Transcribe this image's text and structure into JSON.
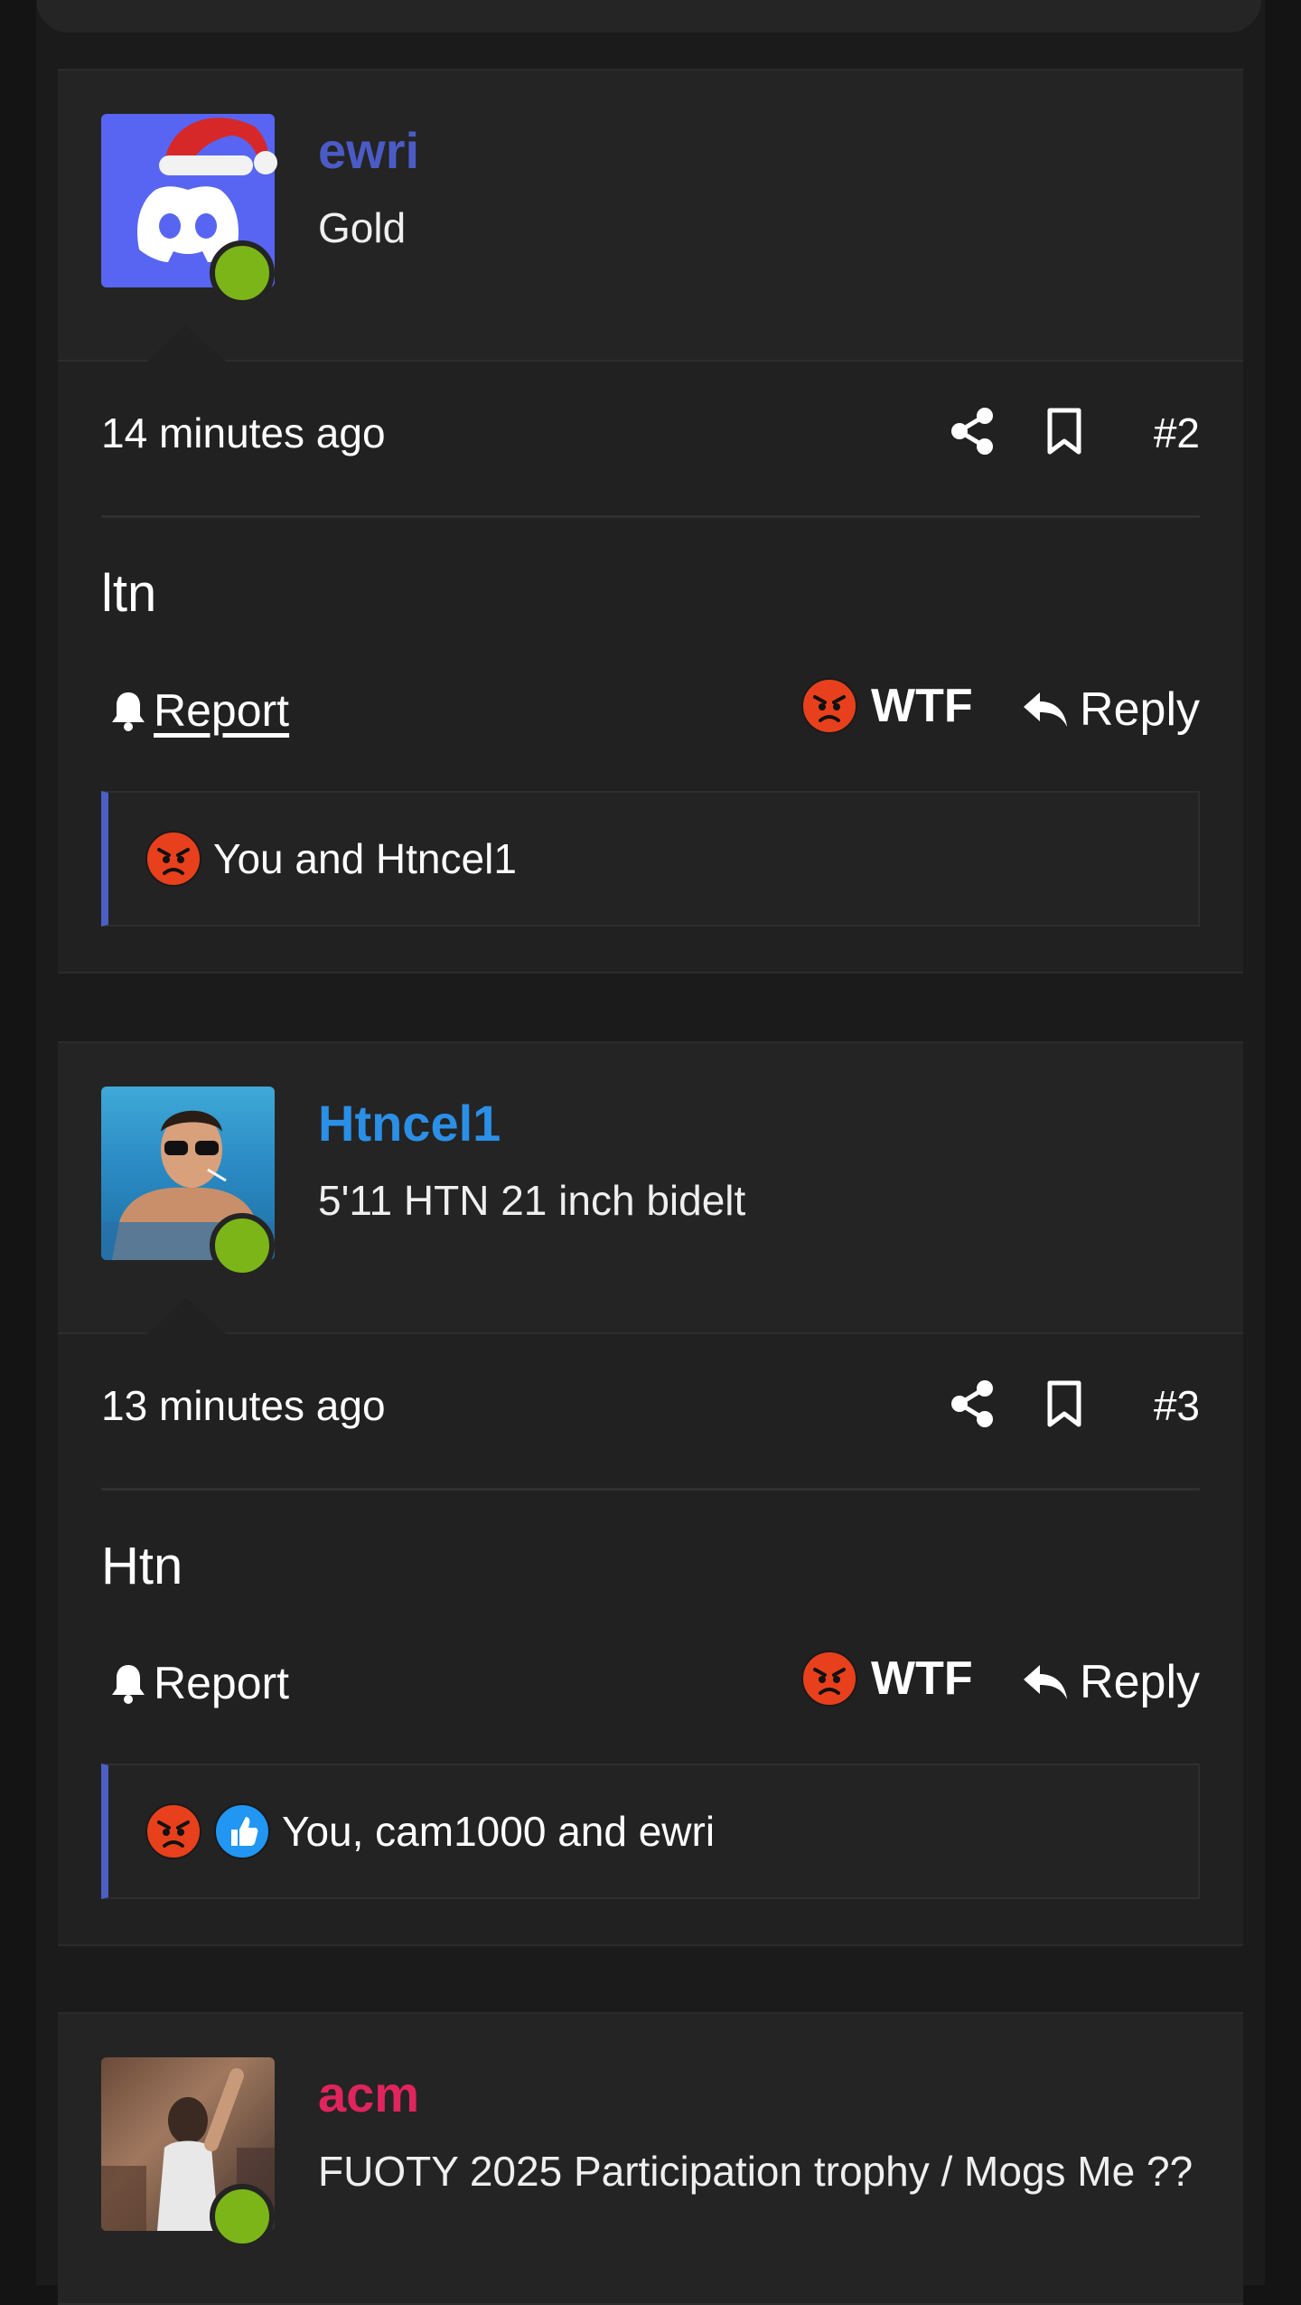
{
  "colors": {
    "page_bg": "#141414",
    "post_bg": "#212121",
    "online": "#7cb518",
    "reaction_accent": "#4b5fc4",
    "angry": "#e8401c",
    "like": "#2196f3"
  },
  "posts": [
    {
      "username": "ewri",
      "username_color": "#4b5bc6",
      "user_title": "Gold",
      "avatar": "discord-logo-santa-hat",
      "timestamp": "14 minutes ago",
      "post_number": "#2",
      "body": "ltn",
      "report_label": "Report",
      "reaction_label": "WTF",
      "reply_label": "Reply",
      "reactions_text": "You and Htncel1",
      "reaction_icons": [
        "angry-face"
      ]
    },
    {
      "username": "Htncel1",
      "username_color": "#2b8fe6",
      "user_title": "5'11 HTN 21 inch bidelt",
      "avatar": "man-in-pool-sunglasses",
      "timestamp": "13 minutes ago",
      "post_number": "#3",
      "body": "Htn",
      "report_label": "Report",
      "reaction_label": "WTF",
      "reply_label": "Reply",
      "reactions_text": "You, cam1000 and ewri",
      "reaction_icons": [
        "angry-face",
        "thumbs-up"
      ]
    },
    {
      "username": "acm",
      "username_color": "#e0245e",
      "user_title": "FUOTY 2025 Participation trophy / Mogs Me ??",
      "avatar": "basketball-player-photo"
    }
  ]
}
